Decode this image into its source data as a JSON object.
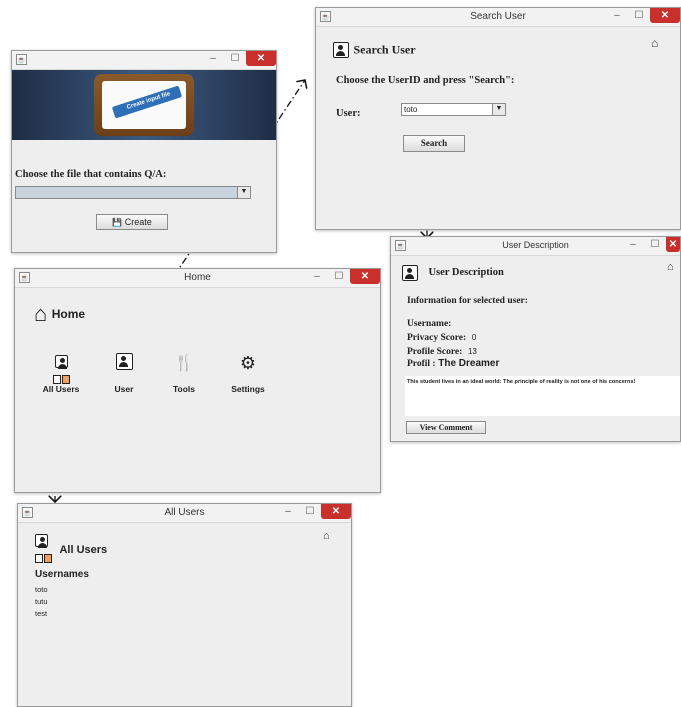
{
  "create_window": {
    "banner_text": "Create input file",
    "prompt": "Choose the file that contains Q/A:",
    "file_value": "",
    "create_label": "Create",
    "minimize": "–",
    "maximize": "☐",
    "close": "✕"
  },
  "search_window": {
    "title": "Search User",
    "heading": "Search User",
    "instruction": "Choose the UserID and press \"Search\":",
    "user_label": "User:",
    "user_value": "toto",
    "search_label": "Search",
    "minimize": "–",
    "maximize": "☐",
    "close": "✕"
  },
  "description_window": {
    "title": "User Description",
    "heading": "User Description",
    "info_label": "Information for selected user:",
    "username_label": "Username:",
    "privacy_label": "Privacy Score:",
    "privacy_value": "0",
    "profile_label": "Profile Score:",
    "profile_value": "13",
    "profil_label": "Profil :",
    "profil_value": "The Dreamer",
    "description": "This student lives in an ideal world: The principle of reality is not one of his concerns!",
    "view_comment_label": "View Comment",
    "minimize": "–",
    "maximize": "☐",
    "close": "✕"
  },
  "home_window": {
    "title": "Home",
    "heading": "Home",
    "items": [
      {
        "label": "All Users",
        "icon": "all-users-icon"
      },
      {
        "label": "User",
        "icon": "user-icon"
      },
      {
        "label": "Tools",
        "icon": "tools-icon"
      },
      {
        "label": "Settings",
        "icon": "settings-icon"
      }
    ],
    "minimize": "–",
    "maximize": "☐",
    "close": "✕"
  },
  "allusers_window": {
    "title": "All Users",
    "heading": "All Users",
    "usernames_label": "Usernames",
    "users": [
      "toto",
      "tutu",
      "test"
    ],
    "minimize": "–",
    "maximize": "☐",
    "close": "✕"
  },
  "colors": {
    "close_red": "#c9302c",
    "window_bg": "#eeeeee",
    "banner_bg": "#2b3f5c"
  }
}
